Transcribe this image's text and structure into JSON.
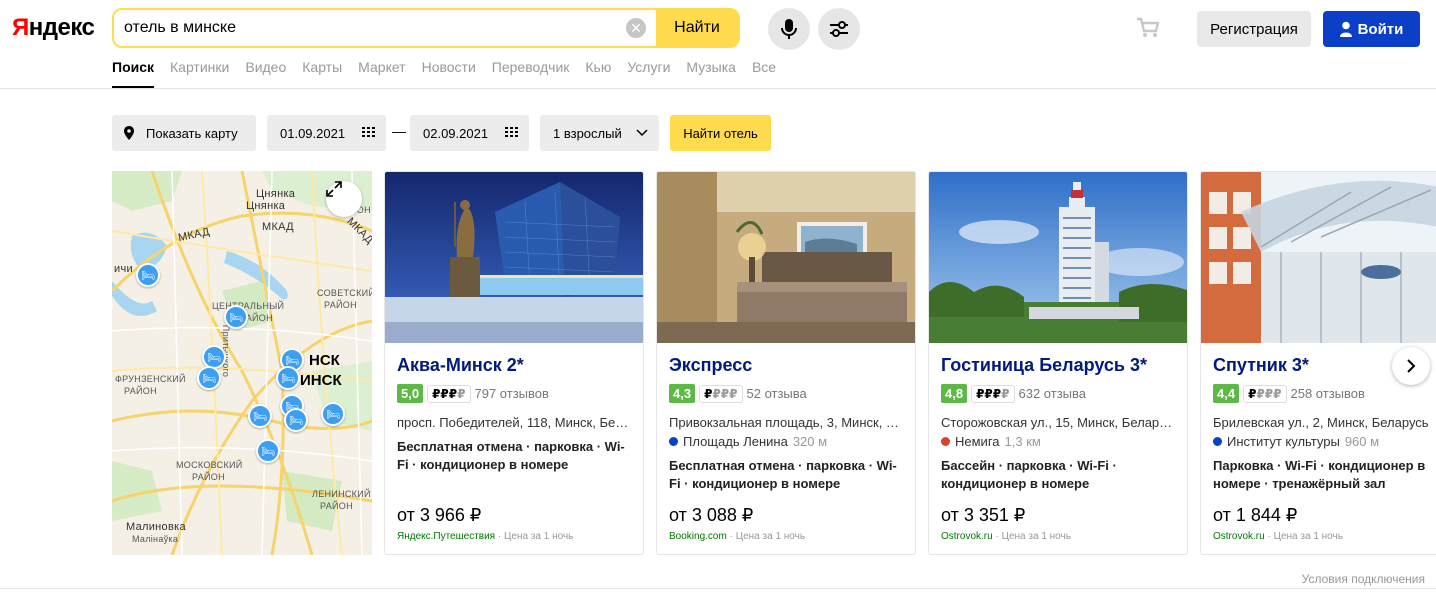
{
  "header": {
    "logo_first": "Я",
    "logo_rest": "ндекс",
    "search_value": "отель в минске",
    "search_button": "Найти",
    "register_button": "Регистрация",
    "login_button": "Войти"
  },
  "tabs": [
    "Поиск",
    "Картинки",
    "Видео",
    "Карты",
    "Маркет",
    "Новости",
    "Переводчик",
    "Кью",
    "Услуги",
    "Музыка",
    "Все"
  ],
  "filters": {
    "show_map": "Показать карту",
    "date_from": "01.09.2021",
    "date_to": "02.09.2021",
    "guests": "1 взрослый",
    "find_hotel": "Найти отель"
  },
  "map": {
    "labels": {
      "tsnyanka1": "Цнянка",
      "tsnyanka2": "Цнянка",
      "mkad1": "МКАД",
      "mkad2": "МКАД",
      "mkad3": "МКАД",
      "rayon_r": "РАЙОН",
      "sovetsky": "СОВЕТСКИЙ",
      "sovetsky_r": "РАЙОН",
      "central": "ЦЕНТРАЛЬНЫЙ",
      "central_r": "РАЙОН",
      "frunz": "ФРУНЗЕНСКИЙ",
      "frunz_r": "РАЙОН",
      "nsk1": "НСК",
      "nsk2": "ИНСК",
      "moskov": "МОСКОВСКИЙ",
      "moskov_r": "РАЙОН",
      "lenin": "ЛЕНИНСКИЙ",
      "lenin_r": "РАЙОН",
      "malinovka1": "Малиновка",
      "malinovka2": "Малінаўка",
      "partial_left": "ичи",
      "street": "Притыцкого"
    }
  },
  "hotels": [
    {
      "name": "Аква-Минск 2*",
      "rating": "5,0",
      "price_level_active": "₽₽₽",
      "price_level_inactive": "₽",
      "reviews": "797 отзывов",
      "address": "просп. Победителей, 118, Минск, Бе…",
      "metro": "",
      "metro_distance": "",
      "metro_color": "",
      "amenities": "Бесплатная отмена · парковка · Wi-Fi · кондиционер в номере",
      "price": "от 3 966 ₽",
      "source": "Яндекс.Путешествия",
      "price_note": " · Цена за 1 ночь"
    },
    {
      "name": "Экспресс",
      "rating": "4,3",
      "price_level_active": "₽",
      "price_level_inactive": "₽₽₽",
      "reviews": "52 отзыва",
      "address": "Привокзальная площадь, 3, Минск, …",
      "metro": "Площадь Ленина",
      "metro_distance": "320 м",
      "metro_color": "#0b3fc7",
      "amenities": "Бесплатная отмена · парковка · Wi-Fi · кондиционер в номере",
      "price": "от 3 088 ₽",
      "source": "Booking.com",
      "price_note": " · Цена за 1 ночь"
    },
    {
      "name": "Гостиница Беларусь 3*",
      "rating": "4,8",
      "price_level_active": "₽₽₽",
      "price_level_inactive": "₽",
      "reviews": "632 отзыва",
      "address": "Сторожовская ул., 15, Минск, Белар…",
      "metro": "Немига",
      "metro_distance": "1,3 км",
      "metro_color": "#d9432e",
      "amenities": "Бассейн · парковка · Wi-Fi · кондиционер в номере",
      "price": "от 3 351 ₽",
      "source": "Ostrovok.ru",
      "price_note": " · Цена за 1 ночь"
    },
    {
      "name": "Спутник 3*",
      "rating": "4,4",
      "price_level_active": "₽",
      "price_level_inactive": "₽₽₽",
      "reviews": "258 отзывов",
      "address": "Брилевская ул., 2, Минск, Беларусь",
      "metro": "Институт культуры",
      "metro_distance": "960 м",
      "metro_color": "#0b3fc7",
      "amenities": "Парковка · Wi-Fi · кондиционер в номере · тренажёрный зал",
      "price": "от 1 844 ₽",
      "source": "Ostrovok.ru",
      "price_note": " · Цена за 1 ночь"
    }
  ],
  "footer": {
    "conditions": "Условия подключения"
  },
  "colors": {
    "yellow": "#ffdb4d",
    "login_blue": "#0b3fc7",
    "hotel_link": "#001a7d",
    "rating_green": "#5eb845"
  }
}
